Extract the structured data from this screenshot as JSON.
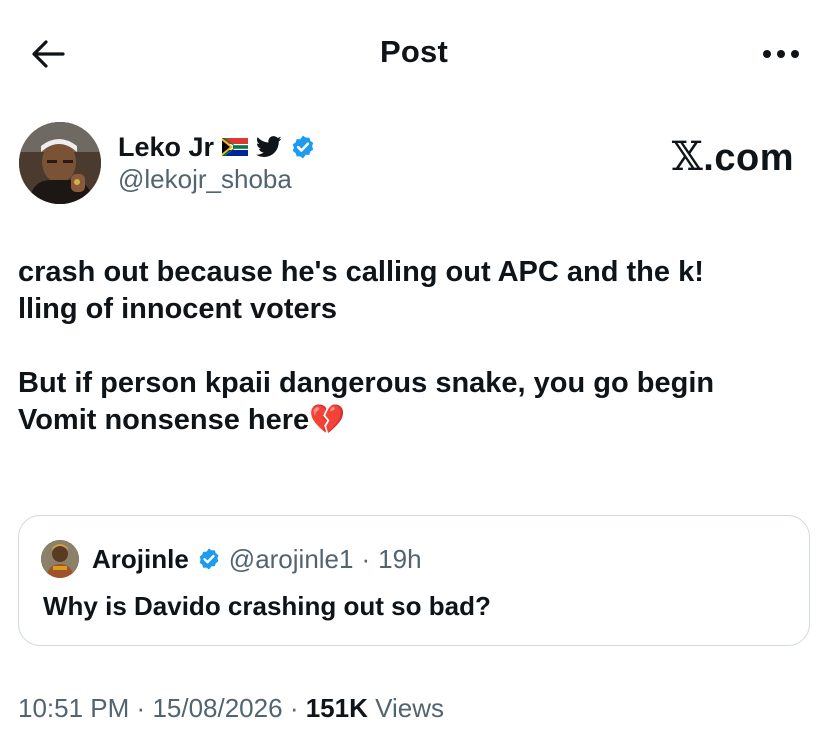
{
  "header": {
    "title": "Post"
  },
  "author": {
    "name": "Leko Jr",
    "handle": "@lekojr_shoba",
    "badges": [
      "south-africa-flag-icon",
      "twitter-bird-icon",
      "verified-badge-icon"
    ]
  },
  "watermark": {
    "text": ".com",
    "x_glyph": "𝕏"
  },
  "tweet": {
    "text": "crash out because he's calling out APC and the k!\nlling of innocent voters\n\nBut if person kpaii dangerous snake, you go begin\nVomit nonsense here💔"
  },
  "quote": {
    "name": "Arojinle",
    "handle": "@arojinle1",
    "separator": "·",
    "time": "19h",
    "text": "Why is Davido crashing out so bad?"
  },
  "footer": {
    "time": "10:51 PM",
    "sep1": "·",
    "date": "15/08/2026",
    "sep2": "·",
    "views_count": "151K",
    "views_label": "Views"
  },
  "colors": {
    "verified": "#1d9bf0",
    "muted": "#536471",
    "text": "#0f1419",
    "border": "#cfd9de"
  }
}
